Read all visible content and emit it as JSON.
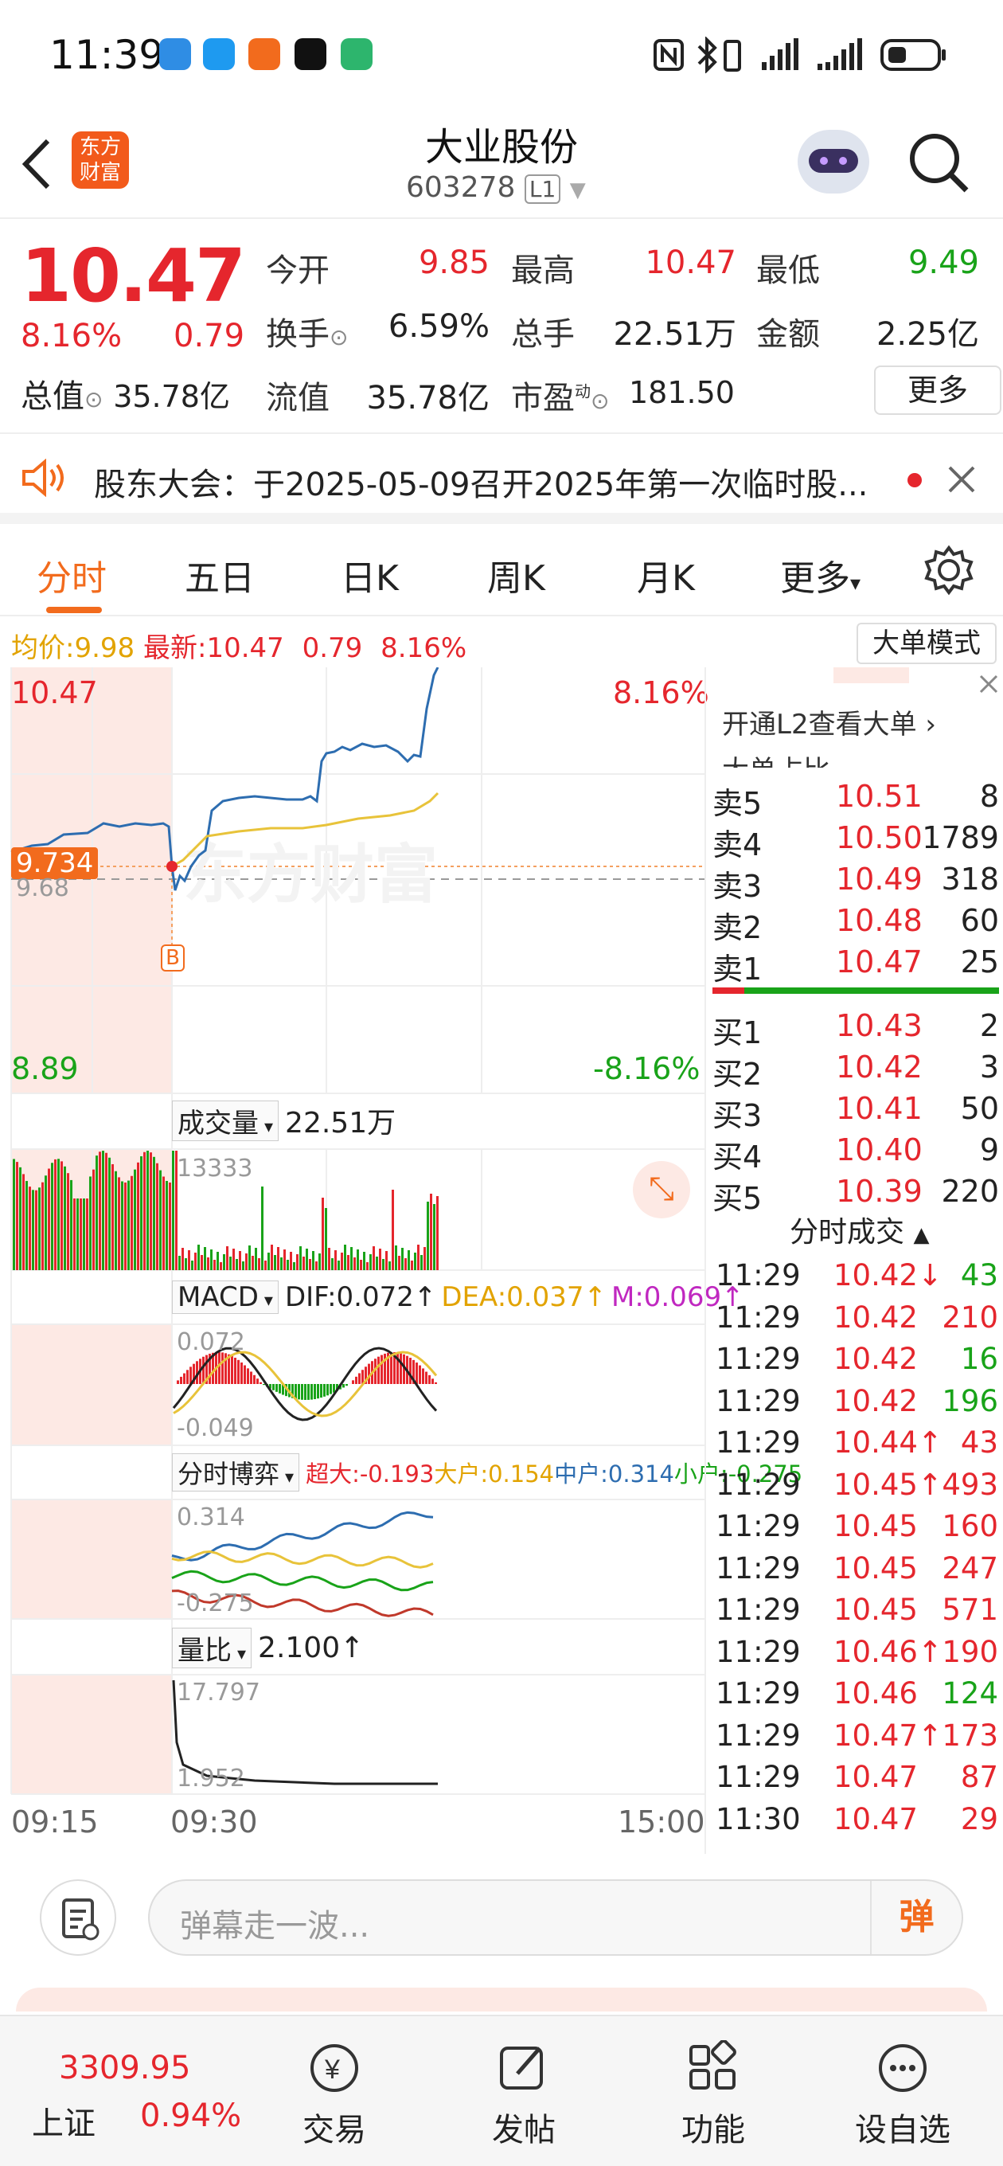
{
  "status_bar": {
    "time": "11:39"
  },
  "header": {
    "title": "大业股份",
    "code": "603278",
    "level": "L1",
    "logo_line1": "东方",
    "logo_line2": "财富"
  },
  "quote": {
    "price": "10.47",
    "pct": "8.16%",
    "change": "0.79",
    "open_label": "今开",
    "open": "9.85",
    "high_label": "最高",
    "high": "10.47",
    "low_label": "最低",
    "low": "9.49",
    "turnover_label": "换手",
    "turnover": "6.59%",
    "volume_label": "总手",
    "volume": "22.51万",
    "amount_label": "金额",
    "amount": "2.25亿",
    "mcap_label": "总值",
    "mcap": "35.78亿",
    "float_label": "流值",
    "float": "35.78亿",
    "pe_label": "市盈",
    "pe_sup": "动",
    "pe": "181.50",
    "more": "更多"
  },
  "notice": {
    "text": "股东大会：于2025-05-09召开2025年第一次临时股..."
  },
  "tabs": [
    "分时",
    "五日",
    "日K",
    "周K",
    "月K",
    "更多"
  ],
  "avg_bar": {
    "avg_label": "均价:",
    "avg": "9.98",
    "last_label": "最新:",
    "last": "10.47",
    "chg": "0.79",
    "pct": "8.16%",
    "mode_btn": "大单模式"
  },
  "chart": {
    "y_top": "10.47",
    "y_top_pct": "8.16%",
    "y_bot": "8.89",
    "y_bot_pct": "-8.16%",
    "ref_tag": "9.734",
    "ref_under": "9.68",
    "watermark": "东方财富",
    "b_marker": "B",
    "volume": {
      "label": "成交量",
      "value": "22.51万",
      "max": "13333"
    },
    "macd": {
      "label": "MACD",
      "dif": "DIF:0.072↑",
      "dea": "DEA:0.037↑",
      "m": "M:0.069↑",
      "top": "0.072",
      "bot": "-0.049"
    },
    "game": {
      "label": "分时博弈",
      "super": "超大:-0.193",
      "large": "大户:0.154",
      "mid": "中户:0.314",
      "small": "小户:-0.275",
      "top": "0.314",
      "bot": "-0.275"
    },
    "ratio": {
      "label": "量比",
      "value": "2.100↑",
      "top": "17.797",
      "bot": "1.952"
    },
    "time_axis": [
      "09:15",
      "09:30",
      "15:00"
    ],
    "colors": {
      "red": "#e5262d",
      "green": "#19a319",
      "blue": "#2d6db0",
      "yellow": "#e8c33a"
    }
  },
  "orderbook": {
    "l2_link": "开通L2查看大单",
    "big_label": "大单占比",
    "asks": [
      {
        "n": "卖5",
        "p": "10.51",
        "q": "8"
      },
      {
        "n": "卖4",
        "p": "10.50",
        "q": "1789"
      },
      {
        "n": "卖3",
        "p": "10.49",
        "q": "318"
      },
      {
        "n": "卖2",
        "p": "10.48",
        "q": "60"
      },
      {
        "n": "卖1",
        "p": "10.47",
        "q": "25"
      }
    ],
    "bids": [
      {
        "n": "买1",
        "p": "10.43",
        "q": "2"
      },
      {
        "n": "买2",
        "p": "10.42",
        "q": "3"
      },
      {
        "n": "买3",
        "p": "10.41",
        "q": "50"
      },
      {
        "n": "买4",
        "p": "10.40",
        "q": "9"
      },
      {
        "n": "买5",
        "p": "10.39",
        "q": "220"
      }
    ],
    "trades_title": "分时成交",
    "trades": [
      {
        "t": "11:29",
        "p": "10.42↓",
        "q": "43",
        "c": "green"
      },
      {
        "t": "11:29",
        "p": "10.42",
        "q": "210",
        "c": "red"
      },
      {
        "t": "11:29",
        "p": "10.42",
        "q": "16",
        "c": "green"
      },
      {
        "t": "11:29",
        "p": "10.42",
        "q": "196",
        "c": "green"
      },
      {
        "t": "11:29",
        "p": "10.44↑",
        "q": "43",
        "c": "red"
      },
      {
        "t": "11:29",
        "p": "10.45↑",
        "q": "493",
        "c": "red"
      },
      {
        "t": "11:29",
        "p": "10.45",
        "q": "160",
        "c": "red"
      },
      {
        "t": "11:29",
        "p": "10.45",
        "q": "247",
        "c": "red"
      },
      {
        "t": "11:29",
        "p": "10.45",
        "q": "571",
        "c": "red"
      },
      {
        "t": "11:29",
        "p": "10.46↑",
        "q": "190",
        "c": "red"
      },
      {
        "t": "11:29",
        "p": "10.46",
        "q": "124",
        "c": "green"
      },
      {
        "t": "11:29",
        "p": "10.47↑",
        "q": "173",
        "c": "red"
      },
      {
        "t": "11:29",
        "p": "10.47",
        "q": "87",
        "c": "red"
      },
      {
        "t": "11:30",
        "p": "10.47",
        "q": "29",
        "c": "red"
      }
    ]
  },
  "comment": {
    "placeholder": "弹幕走一波...",
    "danmu_btn": "弹"
  },
  "navbar": {
    "index_value": "3309.95",
    "index_name": "上证",
    "index_pct": "0.94%",
    "items": [
      "交易",
      "发帖",
      "功能",
      "设自选"
    ]
  }
}
